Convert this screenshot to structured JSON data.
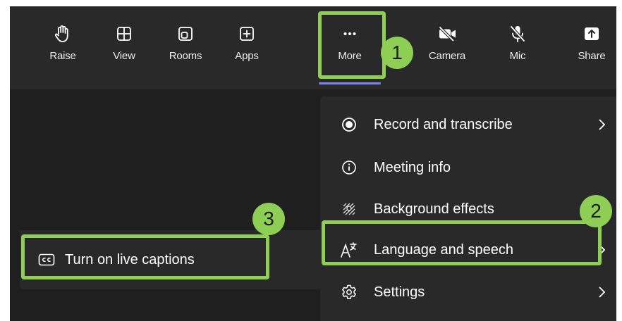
{
  "toolbar": {
    "buttons": [
      {
        "label": "Raise",
        "icon": "raise-hand-icon"
      },
      {
        "label": "View",
        "icon": "view-layout-icon"
      },
      {
        "label": "Rooms",
        "icon": "breakout-rooms-icon"
      },
      {
        "label": "Apps",
        "icon": "apps-add-icon"
      },
      {
        "label": "More",
        "icon": "more-ellipsis-icon"
      },
      {
        "label": "Camera",
        "icon": "camera-off-icon"
      },
      {
        "label": "Mic",
        "icon": "mic-off-icon"
      },
      {
        "label": "Share",
        "icon": "share-tray-icon"
      }
    ],
    "active": "More",
    "active_underline_color": "#7f85f5"
  },
  "more_menu": {
    "items": [
      {
        "label": "Record and transcribe",
        "icon": "record-icon",
        "has_submenu": true
      },
      {
        "label": "Meeting info",
        "icon": "info-icon",
        "has_submenu": false
      },
      {
        "label": "Background effects",
        "icon": "background-effects-icon",
        "has_submenu": false
      },
      {
        "label": "Language and speech",
        "icon": "language-speech-icon",
        "has_submenu": true
      },
      {
        "label": "Settings",
        "icon": "settings-gear-icon",
        "has_submenu": true
      }
    ]
  },
  "language_submenu": {
    "items": [
      {
        "label": "Turn on live captions",
        "icon": "closed-captions-icon"
      }
    ]
  },
  "callouts": [
    {
      "number": "1"
    },
    {
      "number": "2"
    },
    {
      "number": "3"
    }
  ],
  "colors": {
    "highlight": "#8fce55",
    "panel": "#292929",
    "background": "#1f1f1f"
  }
}
